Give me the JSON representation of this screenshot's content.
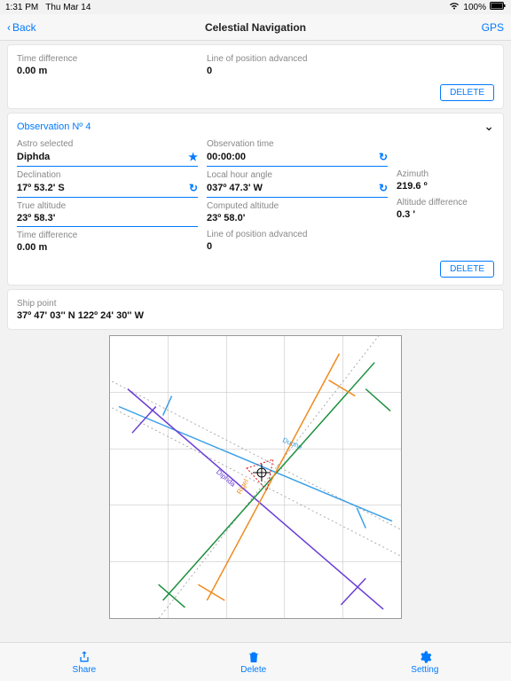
{
  "statusbar": {
    "time": "1:31 PM",
    "date": "Thu Mar 14",
    "battery": "100%"
  },
  "nav": {
    "back": "Back",
    "title": "Celestial Navigation",
    "gps": "GPS"
  },
  "topcard": {
    "time_diff_label": "Time difference",
    "time_diff_value": "0.00 m",
    "lop_label": "Line of position advanced",
    "lop_value": "0",
    "delete": "DELETE"
  },
  "obs": {
    "title": "Observation Nº 4",
    "astro_label": "Astro selected",
    "astro_value": "Diphda",
    "decl_label": "Declination",
    "decl_value": "17º 53.2' S",
    "truealt_label": "True altitude",
    "truealt_value": "23º 58.3'",
    "timed_label": "Time difference",
    "timed_value": "0.00 m",
    "obstime_label": "Observation time",
    "obstime_value": "00:00:00",
    "lha_label": "Local hour angle",
    "lha_value": "037º 47.3' W",
    "compalt_label": "Computed altitude",
    "compalt_value": "23º 58.0'",
    "lop_label": "Line of position advanced",
    "lop_value": "0",
    "az_label": "Azimuth",
    "az_value": "219.6 º",
    "altdiff_label": "Altitude difference",
    "altdiff_value": "0.3 '",
    "delete": "DELETE"
  },
  "ship": {
    "label": "Ship point",
    "value": "37º 47' 03'' N 122º 24' 30'' W"
  },
  "chart_labels": {
    "dubhe": "Dubhe",
    "diphda": "Diphda",
    "rigel": "Rigel"
  },
  "toolbar": {
    "share": "Share",
    "delete": "Delete",
    "setting": "Setting"
  }
}
